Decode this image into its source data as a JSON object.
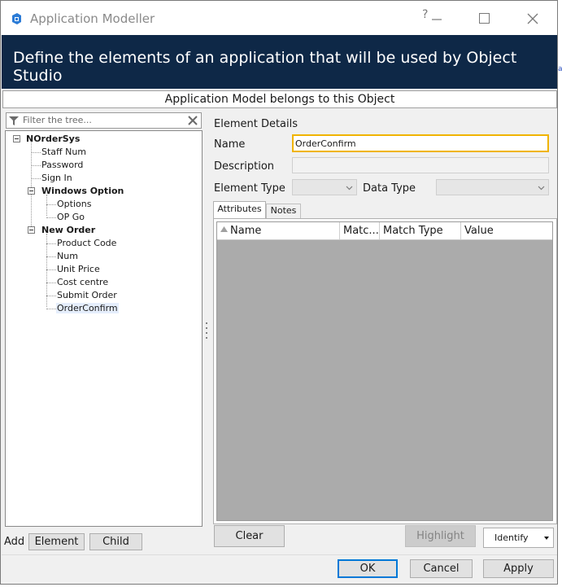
{
  "window": {
    "title": "Application Modeller",
    "help_glyph": "?",
    "banner": "Define the elements of an application that will be used by Object Studio",
    "object_strip": "Application Model belongs to this Object"
  },
  "tree": {
    "filter_placeholder": "Filter the tree...",
    "items": [
      {
        "label": "NOrderSys",
        "bold": true,
        "level": 0,
        "expanded": true
      },
      {
        "label": "Staff Num",
        "bold": false,
        "level": 1
      },
      {
        "label": "Password",
        "bold": false,
        "level": 1
      },
      {
        "label": "Sign In",
        "bold": false,
        "level": 1
      },
      {
        "label": "Windows Option",
        "bold": true,
        "level": 1,
        "expanded": true
      },
      {
        "label": "Options",
        "bold": false,
        "level": 2
      },
      {
        "label": "OP Go",
        "bold": false,
        "level": 2
      },
      {
        "label": "New Order",
        "bold": true,
        "level": 1,
        "expanded": true
      },
      {
        "label": "Product Code",
        "bold": false,
        "level": 2
      },
      {
        "label": "Num",
        "bold": false,
        "level": 2
      },
      {
        "label": "Unit Price",
        "bold": false,
        "level": 2
      },
      {
        "label": "Cost centre",
        "bold": false,
        "level": 2
      },
      {
        "label": "Submit Order",
        "bold": false,
        "level": 2
      },
      {
        "label": "OrderConfirm",
        "bold": false,
        "level": 2,
        "selected": true
      }
    ]
  },
  "add_bar": {
    "label": "Add",
    "element_button": "Element",
    "child_button": "Child"
  },
  "details": {
    "section_label": "Element Details",
    "name_label": "Name",
    "name_value": "OrderConfirm",
    "description_label": "Description",
    "description_value": "",
    "element_type_label": "Element Type",
    "element_type_value": "",
    "data_type_label": "Data Type",
    "data_type_value": ""
  },
  "tabs": {
    "attributes": "Attributes",
    "notes": "Notes",
    "active": "attributes"
  },
  "grid": {
    "columns": [
      "Name",
      "Matc...",
      "Match Type",
      "Value"
    ],
    "rows": []
  },
  "actions": {
    "clear": "Clear",
    "highlight": "Highlight",
    "identify": "Identify",
    "ok": "OK",
    "cancel": "Cancel",
    "apply": "Apply"
  },
  "colors": {
    "banner_bg": "#0e2847",
    "focus_border": "#f0b400",
    "default_button_border": "#0078d7",
    "grid_bg": "#ababab"
  },
  "outside_mark": "a"
}
